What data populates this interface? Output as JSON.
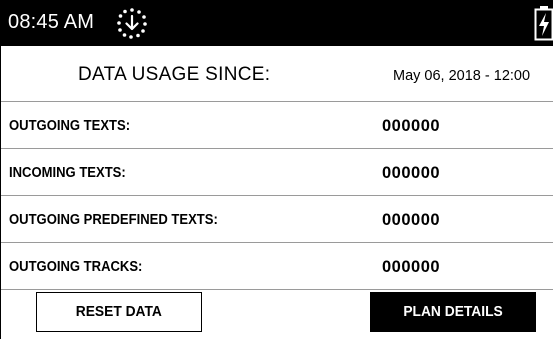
{
  "status_bar": {
    "time": "08:45 AM",
    "sync_icon": "sync-download-icon",
    "battery_icon": "battery-charging-icon"
  },
  "header": {
    "label": "DATA USAGE SINCE:",
    "date": "May 06, 2018 - 12:00"
  },
  "rows": [
    {
      "label": "OUTGOING TEXTS:",
      "value": "000000"
    },
    {
      "label": "INCOMING TEXTS:",
      "value": "000000"
    },
    {
      "label": "OUTGOING PREDEFINED TEXTS:",
      "value": "000000"
    },
    {
      "label": "OUTGOING TRACKS:",
      "value": "000000"
    }
  ],
  "buttons": {
    "reset_label": "RESET DATA",
    "plan_label": "PLAN DETAILS"
  },
  "colors": {
    "status_bar_bg": "#000000",
    "divider": "#9a9a9a",
    "primary_button_bg": "#000000"
  }
}
